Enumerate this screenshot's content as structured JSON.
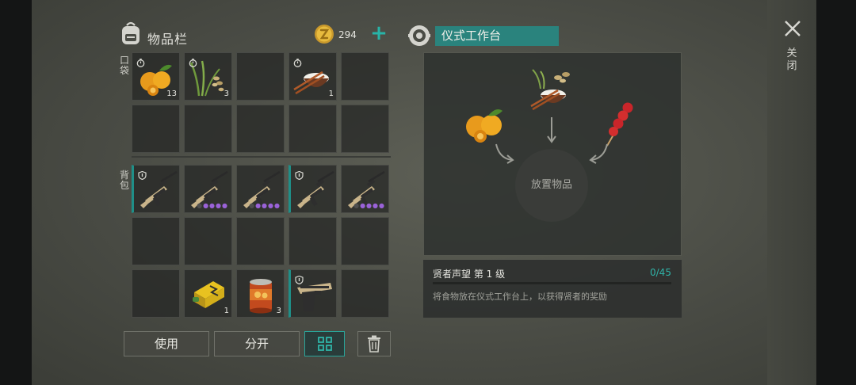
{
  "inventory": {
    "title": "物品栏",
    "coin_count": "294",
    "pocket_label": "口袋",
    "backpack_label": "背包",
    "pocket_slots": [
      {
        "item": "kumquat",
        "qty": "13",
        "tag": "timer"
      },
      {
        "item": "rice-plant",
        "qty": "3",
        "tag": "timer"
      },
      {
        "item": "empty",
        "qty": ""
      },
      {
        "item": "rice-bowl",
        "qty": "1",
        "tag": "timer"
      },
      {
        "item": "empty",
        "qty": ""
      },
      {
        "item": "empty",
        "qty": ""
      },
      {
        "item": "empty",
        "qty": ""
      },
      {
        "item": "empty",
        "qty": ""
      },
      {
        "item": "empty",
        "qty": ""
      },
      {
        "item": "empty",
        "qty": ""
      }
    ],
    "backpack_slots": [
      {
        "item": "rifle",
        "qty": "",
        "tag": "shield",
        "rarity": 0
      },
      {
        "item": "rifle",
        "qty": "",
        "rarity": 4
      },
      {
        "item": "rifle",
        "qty": "",
        "rarity": 4
      },
      {
        "item": "rifle",
        "qty": "",
        "tag": "shield",
        "rarity": 0
      },
      {
        "item": "rifle",
        "qty": "",
        "rarity": 4
      },
      {
        "item": "empty",
        "qty": ""
      },
      {
        "item": "empty",
        "qty": ""
      },
      {
        "item": "empty",
        "qty": ""
      },
      {
        "item": "empty",
        "qty": ""
      },
      {
        "item": "empty",
        "qty": ""
      },
      {
        "item": "empty",
        "qty": ""
      },
      {
        "item": "battery",
        "qty": "1"
      },
      {
        "item": "can",
        "qty": "3"
      },
      {
        "item": "pistol",
        "qty": "",
        "tag": "shield"
      },
      {
        "item": "empty",
        "qty": ""
      }
    ],
    "buttons": {
      "use": "使用",
      "split": "分开"
    }
  },
  "workbench": {
    "title": "仪式工作台",
    "drop_label": "放置物品",
    "reputation_name": "贤者声望 第 1 级",
    "reputation_progress": "0/45",
    "reputation_value": 0,
    "reputation_max": 45,
    "description": "将食物放在仪式工作台上，以获得贤者的奖励"
  },
  "close_label": "关闭",
  "colors": {
    "accent": "#2a837d",
    "highlight": "#2fb4a8",
    "rarity": "#9a62d8"
  }
}
